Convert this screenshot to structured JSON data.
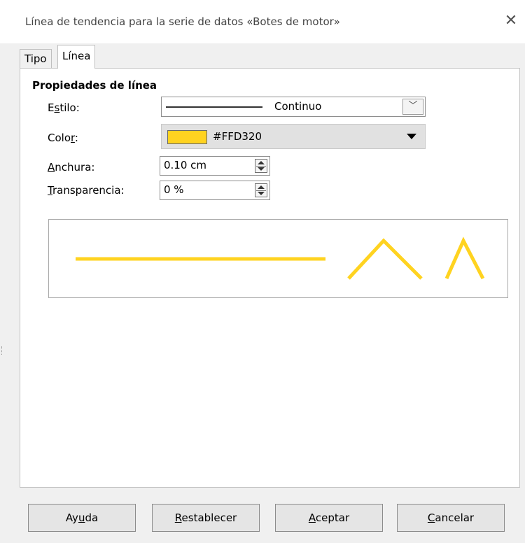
{
  "window": {
    "title": "Línea de tendencia para la serie de datos «Botes de motor»",
    "close_icon": "close-icon"
  },
  "tabs": [
    {
      "label": "Tipo"
    },
    {
      "label": "Línea"
    }
  ],
  "line_properties": {
    "heading": "Propiedades de línea",
    "style": {
      "label_pre": "E",
      "label_u": "s",
      "label_post": "tilo:",
      "value": "Continuo"
    },
    "color": {
      "label_pre": "Colo",
      "label_u": "r",
      "label_post": ":",
      "value": "#FFD320",
      "swatch": "#FFD320"
    },
    "width": {
      "label_u": "A",
      "label_post": "nchura:",
      "value": "0.10 cm"
    },
    "transparency": {
      "label_u": "T",
      "label_post": "ransparencia:",
      "value": "0 %"
    }
  },
  "preview": {
    "line_color": "#FFD320"
  },
  "buttons": {
    "help": {
      "pre": "Ay",
      "u": "u",
      "post": "da"
    },
    "reset": {
      "pre": "",
      "u": "R",
      "post": "establecer"
    },
    "ok": {
      "pre": "",
      "u": "A",
      "post": "ceptar"
    },
    "cancel": {
      "pre": "",
      "u": "C",
      "post": "ancelar"
    }
  }
}
